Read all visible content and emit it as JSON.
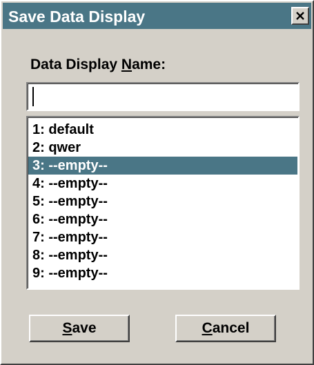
{
  "window": {
    "title": "Save Data Display",
    "close_icon": "close-icon"
  },
  "form": {
    "name_label_pre": "Data Display ",
    "name_label_mnemonic": "N",
    "name_label_post": "ame:",
    "name_value": ""
  },
  "list": {
    "selected_index": 2,
    "items": [
      {
        "label": "1: default"
      },
      {
        "label": "2: qwer"
      },
      {
        "label": "3: --empty--"
      },
      {
        "label": "4: --empty--"
      },
      {
        "label": "5: --empty--"
      },
      {
        "label": "6: --empty--"
      },
      {
        "label": "7: --empty--"
      },
      {
        "label": "8: --empty--"
      },
      {
        "label": "9: --empty--"
      }
    ]
  },
  "buttons": {
    "save_mnemonic": "S",
    "save_rest": "ave",
    "cancel_mnemonic": "C",
    "cancel_rest": "ancel"
  },
  "colors": {
    "title_bar": "#4a7686",
    "selection": "#4a7686",
    "face": "#d4d0c8"
  }
}
